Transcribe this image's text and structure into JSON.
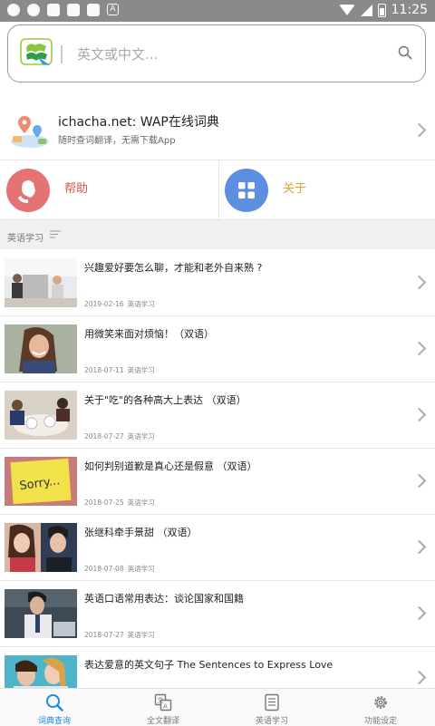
{
  "status_bar": {
    "time": "11:25"
  },
  "search": {
    "placeholder": "英文或中文..."
  },
  "banner": {
    "title": "ichacha.net: WAP在线词典",
    "subtitle": "随时查词翻译，无需下载App"
  },
  "quick_links": [
    {
      "label": "帮助",
      "color": "#e57373",
      "label_color": "#d9534f"
    },
    {
      "label": "关于",
      "color": "#5c8fe0",
      "label_color": "#e6a22a"
    }
  ],
  "section": {
    "title": "英语学习"
  },
  "articles": [
    {
      "title": "兴趣爱好要怎么聊，才能和老外自来熟 ?",
      "date": "2019-02-16",
      "category": "英语学习",
      "thumb": "people-in-office"
    },
    {
      "title": "用微笑来面对烦恼！（双语）",
      "date": "2018-07-11",
      "category": "英语学习",
      "thumb": "smiling-woman"
    },
    {
      "title": "关于\"吃\"的各种高大上表达 （双语）",
      "date": "2018-07-27",
      "category": "英语学习",
      "thumb": "dining-table"
    },
    {
      "title": "如何判别道歉是真心还是假意 （双语）",
      "date": "2018-07-25",
      "category": "英语学习",
      "thumb": "sorry-note"
    },
    {
      "title": "张继科牵手景甜 （双语）",
      "date": "2018-07-08",
      "category": "英语学习",
      "thumb": "celebrity-couple"
    },
    {
      "title": "英语口语常用表达：谈论国家和国籍",
      "date": "2018-07-27",
      "category": "英语学习",
      "thumb": "business-man"
    },
    {
      "title": "表达爱意的英文句子 The Sentences to Express Love",
      "date": "",
      "category": "",
      "thumb": "couple"
    }
  ],
  "tabs": [
    {
      "label": "词典查询",
      "icon": "search-icon",
      "active": true
    },
    {
      "label": "全文翻译",
      "icon": "translate-icon",
      "active": false
    },
    {
      "label": "英语学习",
      "icon": "book-icon",
      "active": false
    },
    {
      "label": "功能设定",
      "icon": "gear-icon",
      "active": false
    }
  ],
  "colors": {
    "accent": "#1e88e5"
  }
}
